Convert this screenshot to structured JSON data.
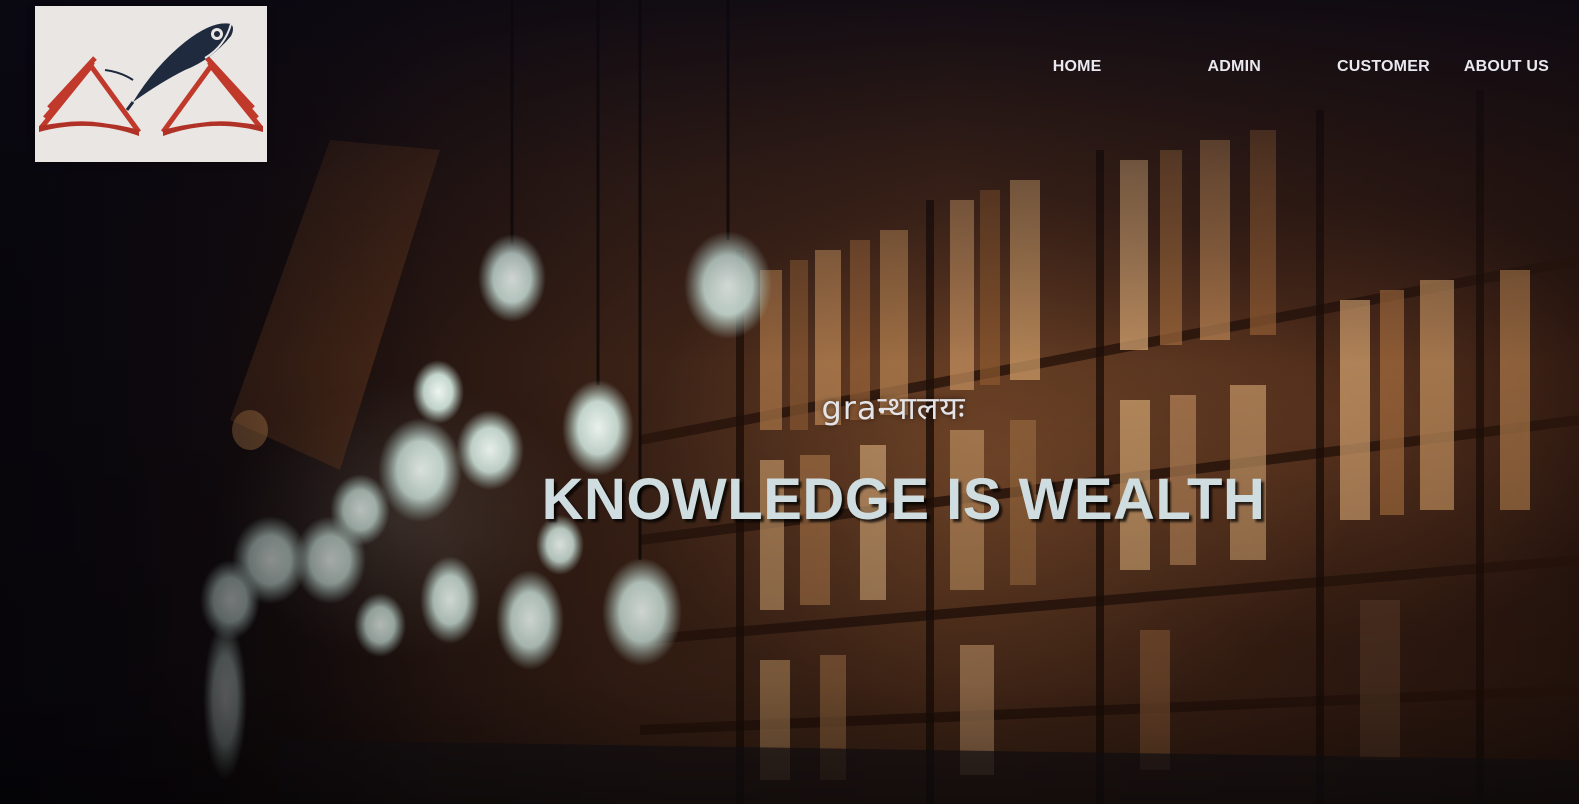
{
  "logo": {
    "icon": "open-book-with-quill-pen"
  },
  "nav": {
    "items": [
      {
        "label": "HOME"
      },
      {
        "label": "ADMIN"
      },
      {
        "label": "CUSTOMER"
      },
      {
        "label": "ABOUT US"
      }
    ]
  },
  "hero": {
    "tagline": "graन्थालयः",
    "headline": "KNOWLEDGE IS WEALTH",
    "background": "library-bookshelves-with-hanging-bulbs"
  },
  "colors": {
    "nav_text": "#e8e8ee",
    "headline": "#cfdde0",
    "book_red": "#c0392b",
    "quill": "#1f2a3f"
  }
}
